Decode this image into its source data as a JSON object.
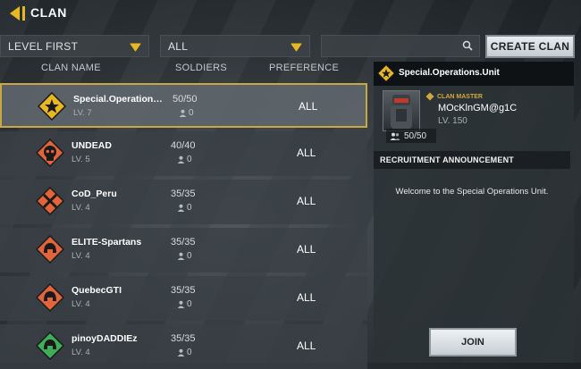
{
  "header": {
    "title": "CLAN"
  },
  "filters": {
    "sort_label": "LEVEL FIRST",
    "preference_label": "ALL",
    "search_placeholder": "",
    "create_label": "CREATE CLAN"
  },
  "columns": {
    "name": "CLAN NAME",
    "soldiers": "SOLDIERS",
    "preference": "PREFERENCE"
  },
  "clans": [
    {
      "name": "Special.Operations.Uni...",
      "level": "LV. 7",
      "soldiers": "50/50",
      "online": "0",
      "preference": "ALL",
      "emblem_color": "#e8b820",
      "emblem_icon": "star-emblem-icon"
    },
    {
      "name": "UNDEAD",
      "level": "LV. 5",
      "soldiers": "40/40",
      "online": "0",
      "preference": "ALL",
      "emblem_color": "#e2643a",
      "emblem_icon": "skull-emblem-icon"
    },
    {
      "name": "CoD_Peru",
      "level": "LV. 4",
      "soldiers": "35/35",
      "online": "0",
      "preference": "ALL",
      "emblem_color": "#e2643a",
      "emblem_icon": "crossed-emblem-icon"
    },
    {
      "name": "ELITE-Spartans",
      "level": "LV. 4",
      "soldiers": "35/35",
      "online": "0",
      "preference": "ALL",
      "emblem_color": "#e2643a",
      "emblem_icon": "helmet-emblem-icon"
    },
    {
      "name": "QuebecGTI",
      "level": "LV. 4",
      "soldiers": "35/35",
      "online": "0",
      "preference": "ALL",
      "emblem_color": "#e2643a",
      "emblem_icon": "helmet-emblem-icon"
    },
    {
      "name": "pinoyDADDIEz",
      "level": "LV. 4",
      "soldiers": "35/35",
      "online": "0",
      "preference": "ALL",
      "emblem_color": "#3fae58",
      "emblem_icon": "helmet-emblem-icon"
    }
  ],
  "detail": {
    "clan_name": "Special.Operations.Unit",
    "master_label": "CLAN MASTER",
    "master_name": "MOcKlnGM@g1C",
    "master_level": "LV. 150",
    "members": "50/50",
    "recruitment_title": "RECRUITMENT ANNOUNCEMENT",
    "recruitment_text": "Welcome to the Special Operations Unit.",
    "join_label": "JOIN"
  },
  "colors": {
    "accent": "#e8b820",
    "selected_border": "#c9a842"
  }
}
